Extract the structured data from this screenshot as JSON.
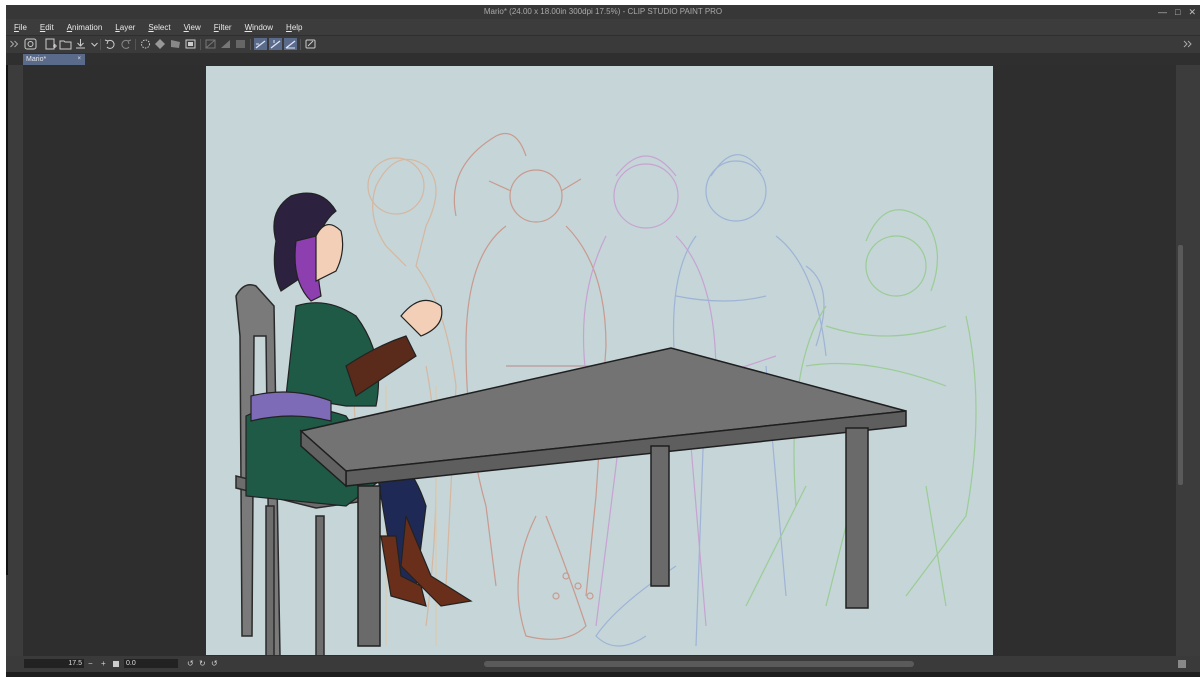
{
  "window": {
    "title": "Mario* (24.00 x 18.00in 300dpi 17.5%)  - CLIP STUDIO PAINT PRO",
    "controls": [
      "minimize-icon",
      "maximize-icon",
      "close-icon"
    ]
  },
  "menu": {
    "items": [
      "File",
      "Edit",
      "Animation",
      "Layer",
      "Select",
      "View",
      "Filter",
      "Window",
      "Help"
    ]
  },
  "toolbar": {
    "icons": [
      "new-icon",
      "open-icon",
      "save-icon",
      "undo-icon",
      "redo-icon",
      "clear-icon",
      "fill-icon",
      "transform-icon",
      "snap-ruler-icon",
      "snap-special-icon",
      "snap-grid-icon",
      "settings-icon"
    ]
  },
  "document_tab": {
    "label": "Mario*",
    "close": "×"
  },
  "status": {
    "zoom": "17.5",
    "angle": "0.0",
    "minus": "−",
    "plus": "+"
  },
  "colors": {
    "chrome": "#3c3c3c",
    "workspace": "#2e2e2e",
    "canvas": "#c5d5d8",
    "accent": "#5a6a8a"
  }
}
